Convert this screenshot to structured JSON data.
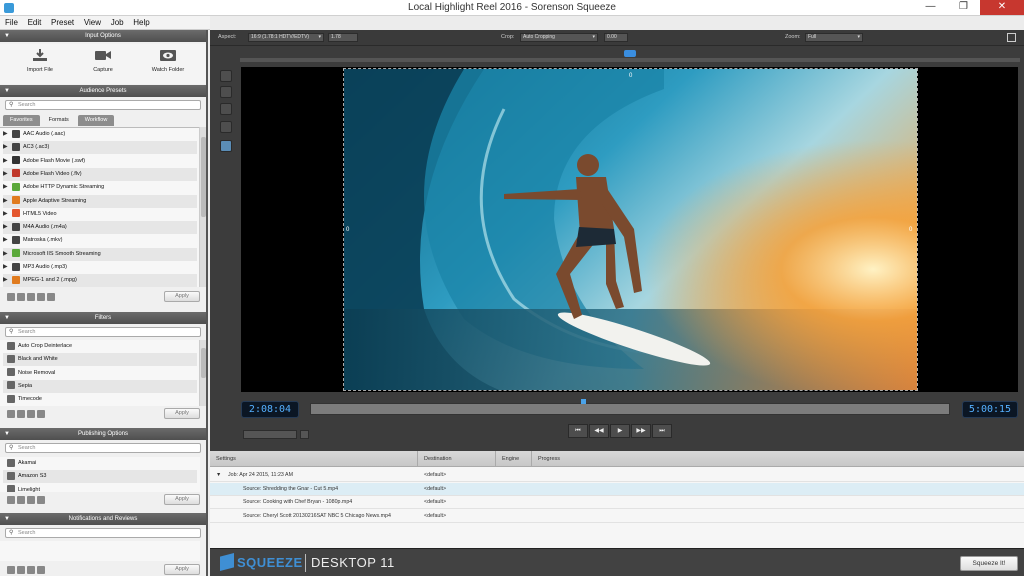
{
  "window": {
    "title": "Local Highlight Reel 2016 - Sorenson Squeeze",
    "minimize": "—",
    "maximize": "❐",
    "close": "✕"
  },
  "menu": [
    "File",
    "Edit",
    "Preset",
    "View",
    "Job",
    "Help"
  ],
  "input_options": {
    "header": "Input Options",
    "buttons": [
      {
        "label": "Import File",
        "icon": "import-icon"
      },
      {
        "label": "Capture",
        "icon": "camera-icon"
      },
      {
        "label": "Watch Folder",
        "icon": "eye-icon"
      }
    ]
  },
  "audience_presets": {
    "header": "Audience Presets",
    "search_placeholder": "Search",
    "tabs": [
      "Favorites",
      "Formats",
      "Workflow"
    ],
    "active_tab": "Formats",
    "items": [
      {
        "label": "AAC Audio (.aac)",
        "color": "#444444"
      },
      {
        "label": "AC3 (.ac3)",
        "color": "#444444"
      },
      {
        "label": "Adobe Flash Movie (.swf)",
        "color": "#333333"
      },
      {
        "label": "Adobe Flash Video (.flv)",
        "color": "#c0392b"
      },
      {
        "label": "Adobe HTTP Dynamic Streaming",
        "color": "#5aa83a"
      },
      {
        "label": "Apple Adaptive Streaming",
        "color": "#e07b1e"
      },
      {
        "label": "HTML5 Video",
        "color": "#e4572e"
      },
      {
        "label": "M4A Audio (.m4a)",
        "color": "#444444"
      },
      {
        "label": "Matroska (.mkv)",
        "color": "#444444"
      },
      {
        "label": "Microsoft IIS Smooth Streaming",
        "color": "#5aa83a"
      },
      {
        "label": "MP3 Audio (.mp3)",
        "color": "#444444"
      },
      {
        "label": "MPEG-1 and 2 (.mpg)",
        "color": "#e07b1e"
      }
    ],
    "apply": "Apply"
  },
  "filters": {
    "header": "Filters",
    "search_placeholder": "Search",
    "items": [
      "Auto Crop Deinterlace",
      "Black and White",
      "Noise Removal",
      "Sepia",
      "Timecode"
    ],
    "apply": "Apply"
  },
  "publishing": {
    "header": "Publishing Options",
    "search_placeholder": "Search",
    "items": [
      "Akamai",
      "Amazon S3",
      "Limelight"
    ],
    "apply": "Apply"
  },
  "notifications": {
    "header": "Notifications and Reviews",
    "search_placeholder": "Search",
    "apply": "Apply"
  },
  "toolbar": {
    "aspect_label": "Aspect:",
    "aspect_value": "16:9 (1.78:1 HDTV/EDTV)",
    "aspect_ratio": "1.78",
    "crop_label": "Crop:",
    "crop_value": "Auto Cropping",
    "crop_amount": "0.00",
    "zoom_label": "Zoom:",
    "zoom_value": "Full"
  },
  "preview": {
    "crop_top": "0",
    "crop_left": "0",
    "crop_right": "0"
  },
  "playback": {
    "in_time": "2:08:04",
    "out_time": "5:00:15",
    "buttons": [
      "⏮",
      "◀◀",
      "▶",
      "▶▶",
      "⏭"
    ]
  },
  "queue": {
    "columns": [
      "Settings",
      "Destination",
      "Engine",
      "Progress"
    ],
    "rows": [
      {
        "settings": "Job: Apr 24 2015, 11:23 AM",
        "destination": "<default>",
        "job": true
      },
      {
        "settings": "Source: Shredding the Gnar - Cut 5.mp4",
        "destination": "<default>",
        "selected": true
      },
      {
        "settings": "Source: Cooking with Chef Bryan - 1080p.mp4",
        "destination": "<default>"
      },
      {
        "settings": "Source: Cheryl Scott 20130216SAT NBC 5 Chicago News.mp4",
        "destination": "<default>"
      }
    ]
  },
  "footer": {
    "brand_left": "SQUEEZE",
    "brand_right": "DESKTOP 11",
    "squeeze_button": "Squeeze It!"
  }
}
